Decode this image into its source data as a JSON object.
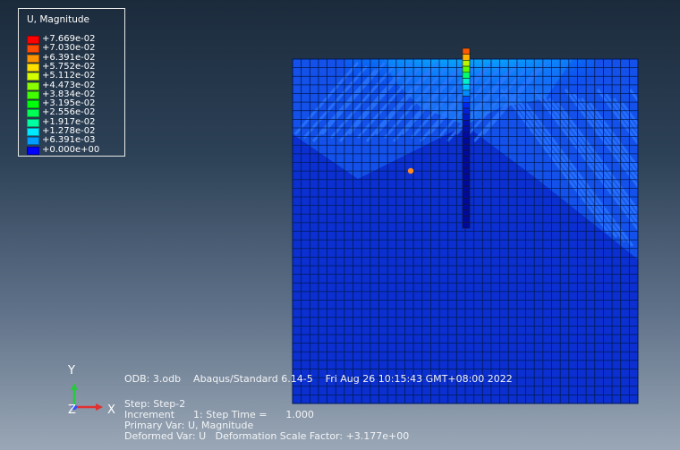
{
  "legend": {
    "title": "U, Magnitude",
    "entries": [
      {
        "label": "+7.669e-02",
        "color": "#ff0000"
      },
      {
        "label": "+7.030e-02",
        "color": "#ff4a00"
      },
      {
        "label": "+6.391e-02",
        "color": "#ff9400"
      },
      {
        "label": "+5.752e-02",
        "color": "#ffdf00"
      },
      {
        "label": "+5.112e-02",
        "color": "#d4ff00"
      },
      {
        "label": "+4.473e-02",
        "color": "#8aff00"
      },
      {
        "label": "+3.834e-02",
        "color": "#40ff00"
      },
      {
        "label": "+3.195e-02",
        "color": "#00ff0b"
      },
      {
        "label": "+2.556e-02",
        "color": "#00ff55"
      },
      {
        "label": "+1.917e-02",
        "color": "#00ffa0"
      },
      {
        "label": "+1.278e-02",
        "color": "#00eaff"
      },
      {
        "label": "+6.391e-03",
        "color": "#009fff"
      },
      {
        "label": "+0.000e+00",
        "color": "#0000ff"
      }
    ]
  },
  "triad": {
    "y": "Y",
    "x": "X",
    "z": "Z"
  },
  "info": {
    "odb_line": "ODB: 3.odb    Abaqus/Standard 6.14-5    Fri Aug 26 10:15:43 GMT+08:00 2022",
    "step_line": "Step: Step-2",
    "increment_line": "Increment      1: Step Time =      1.000",
    "primary_var_line": "Primary Var: U, Magnitude",
    "deformed_var_line": "Deformed Var: U   Deformation Scale Factor: +3.177e+00"
  },
  "colors": {
    "mesh_base": "#0b2fcf",
    "mesh_lines": "#001a55",
    "marker": "#ff8a20"
  }
}
